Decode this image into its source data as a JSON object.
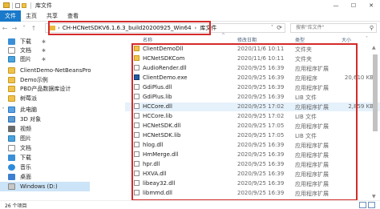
{
  "window": {
    "title": "库文件",
    "controls": {
      "minimize": "—",
      "maximize": "☐",
      "close": "✕"
    }
  },
  "ribbon": {
    "tabs": [
      "文件",
      "主页",
      "共享",
      "查看"
    ]
  },
  "navigation": {
    "back": "←",
    "forward": "→",
    "recent": "˅",
    "up": "↑"
  },
  "address": {
    "crumbs": [
      "CH-HCNetSDKV6.1.6.3_build20200925_Win64",
      "库文件"
    ],
    "separator": "›",
    "dropdown": "˅",
    "refresh": "⟳"
  },
  "search": {
    "placeholder": "搜索\"库文件\"",
    "icon": "search-icon"
  },
  "sidebar": {
    "items": [
      {
        "label": "下载",
        "icon": "download-icon"
      },
      {
        "label": "文档",
        "icon": "document-icon"
      },
      {
        "label": "图片",
        "icon": "picture-icon"
      },
      {
        "label": "ClientDemo-NetBeansPro",
        "icon": "folder-icon"
      },
      {
        "label": "Demo示例",
        "icon": "folder-icon"
      },
      {
        "label": "PBD产品数据库设计",
        "icon": "folder-icon"
      },
      {
        "label": "树莓派",
        "icon": "folder-icon"
      },
      {
        "label": "此电脑",
        "icon": "pc-icon"
      },
      {
        "label": "3D 对象",
        "icon": "3d-objects-icon"
      },
      {
        "label": "视频",
        "icon": "video-icon"
      },
      {
        "label": "图片",
        "icon": "picture-icon"
      },
      {
        "label": "文档",
        "icon": "document-icon"
      },
      {
        "label": "下载",
        "icon": "download-icon"
      },
      {
        "label": "音乐",
        "icon": "music-icon"
      },
      {
        "label": "桌面",
        "icon": "desktop-icon"
      },
      {
        "label": "Windows (D:)",
        "icon": "drive-icon"
      }
    ],
    "pin_glyph": "✱"
  },
  "columns": {
    "name": "名称",
    "date": "修改日期",
    "type": "类型",
    "size": "大小",
    "sort_indicator": "^"
  },
  "files": [
    {
      "name": "ClientDemoDll",
      "date": "2020/11/6 10:11",
      "type": "文件夹",
      "size": "",
      "icon": "folder-icon"
    },
    {
      "name": "HCNetSDKCom",
      "date": "2020/11/6 10:11",
      "type": "文件夹",
      "size": "",
      "icon": "folder-icon"
    },
    {
      "name": "AudioRender.dll",
      "date": "2020/9/25 16:39",
      "type": "应用程序扩展",
      "size": "",
      "icon": "dll-icon"
    },
    {
      "name": "ClientDemo.exe",
      "date": "2020/9/25 16:39",
      "type": "应用程序",
      "size": "20,610 KB",
      "icon": "exe-icon"
    },
    {
      "name": "GdiPlus.dll",
      "date": "2020/9/25 16:39",
      "type": "应用程序扩展",
      "size": "",
      "icon": "dll-icon"
    },
    {
      "name": "GdiPlus.lib",
      "date": "2020/9/25 16:39",
      "type": "LIB 文件",
      "size": "",
      "icon": "lib-icon"
    },
    {
      "name": "HCCore.dll",
      "date": "2020/9/25 17:02",
      "type": "应用程序扩展",
      "size": "2,859 KB",
      "icon": "dll-icon"
    },
    {
      "name": "HCCore.lib",
      "date": "2020/9/25 17:02",
      "type": "LIB 文件",
      "size": "",
      "icon": "lib-icon"
    },
    {
      "name": "HCNetSDK.dll",
      "date": "2020/9/25 17:05",
      "type": "应用程序扩展",
      "size": "",
      "icon": "dll-icon"
    },
    {
      "name": "HCNetSDK.lib",
      "date": "2020/9/25 17:05",
      "type": "LIB 文件",
      "size": "",
      "icon": "lib-icon"
    },
    {
      "name": "hlog.dll",
      "date": "2020/9/25 16:39",
      "type": "应用程序扩展",
      "size": "",
      "icon": "dll-icon"
    },
    {
      "name": "HmMerge.dll",
      "date": "2020/9/25 16:39",
      "type": "应用程序扩展",
      "size": "",
      "icon": "dll-icon"
    },
    {
      "name": "hpr.dll",
      "date": "2020/9/25 16:39",
      "type": "应用程序扩展",
      "size": "",
      "icon": "dll-icon"
    },
    {
      "name": "HXVA.dll",
      "date": "2020/9/25 16:39",
      "type": "应用程序扩展",
      "size": "",
      "icon": "dll-icon"
    },
    {
      "name": "libeay32.dll",
      "date": "2020/9/25 16:39",
      "type": "应用程序扩展",
      "size": "",
      "icon": "dll-icon"
    },
    {
      "name": "libmmd.dll",
      "date": "2020/9/25 16:39",
      "type": "应用程序扩展",
      "size": "",
      "icon": "dll-icon"
    }
  ],
  "status": {
    "count": "26 个项目"
  }
}
